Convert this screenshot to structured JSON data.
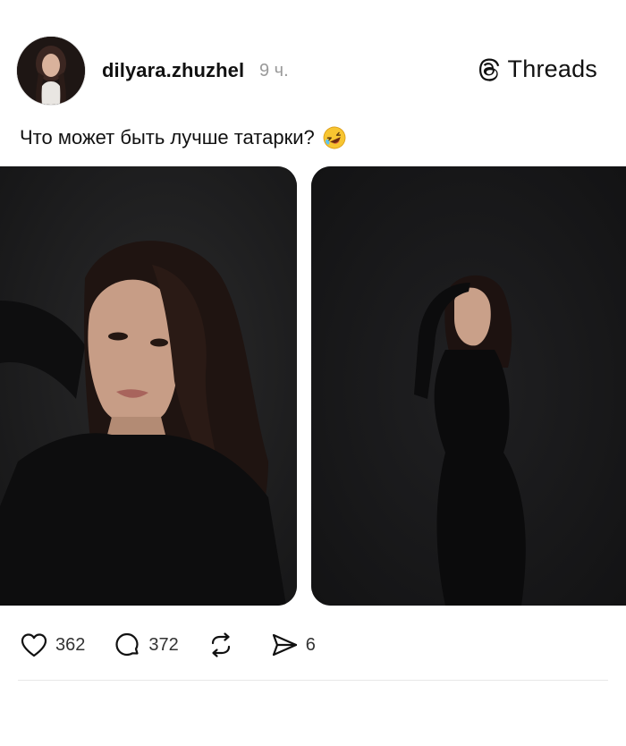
{
  "post": {
    "username": "dilyara.zhuzhel",
    "time": "9 ч.",
    "caption": "Что может быть лучше татарки?",
    "emoji": "rolling-on-floor-laughing"
  },
  "brand": {
    "name": "Threads",
    "icon": "threads-logo-icon"
  },
  "media": [
    {
      "alt": "photo-1"
    },
    {
      "alt": "photo-2"
    }
  ],
  "actions": {
    "likes": "362",
    "comments": "372",
    "reposts": "",
    "shares": "6"
  },
  "colors": {
    "text": "#111111",
    "muted": "#9a9a9a",
    "photo_bg": "#1b1b1c"
  }
}
